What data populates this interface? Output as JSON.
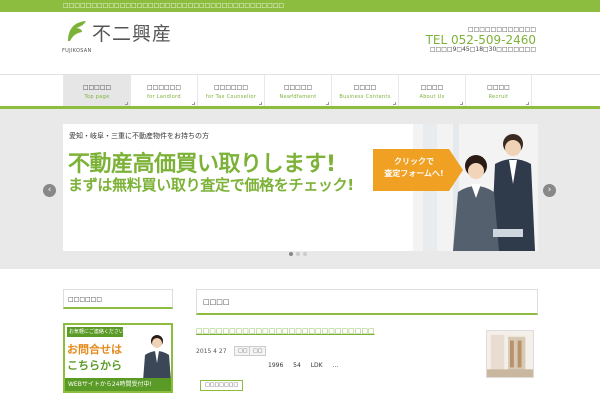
{
  "topbar": {
    "text": "□□□□□□□□□□□□□□□□□□□□□□□□□□□□□□□□□□□□□□□"
  },
  "header": {
    "logo_sub": "FUJIKOSAN",
    "logo_text": "不二興産",
    "company_name": "□□□□□□□□□□□□",
    "tel": "TEL 052-509-2460",
    "hours": "□□□□9□45□18□30□□□□□□□"
  },
  "nav": {
    "items": [
      {
        "jp": "□□□□□",
        "en": "Top page"
      },
      {
        "jp": "□□□□□□",
        "en": "for Landlord"
      },
      {
        "jp": "□□□□□□",
        "en": "for Tax Counsellor"
      },
      {
        "jp": "□□□□□",
        "en": "Newfdfament"
      },
      {
        "jp": "□□□□",
        "en": "Business Contents"
      },
      {
        "jp": "□□□□",
        "en": "About Us"
      },
      {
        "jp": "□□□□",
        "en": "Recruit"
      }
    ]
  },
  "slider": {
    "sub": "愛知・岐阜・三重に不動産物件をお持ちの方",
    "headline": "不動産高価買い取りします!",
    "subheadline": "まずは無料買い取り査定で価格をチェック!",
    "cta": "クリックで\n査定フォームへ!",
    "prev": "‹",
    "next": "›"
  },
  "sidebar": {
    "title": "□□□□□□",
    "banner": {
      "line1": "お気軽にご連絡ください!",
      "line2": "お問合せは",
      "line3": "こちらから",
      "line4": "WEBサイトから24時間受付中!"
    }
  },
  "main": {
    "title": "□□□□",
    "post": {
      "link": "□□□□□□□□□□□□□□□□□□□□□□□□□□□",
      "date": "2015 4 27",
      "tags": [
        "□□",
        "□□"
      ],
      "excerpt": "1996 54 LDK …",
      "more": "□□□□□□□"
    }
  },
  "colors": {
    "accent": "#8cbd3f",
    "accent_text": "#7db238",
    "cta": "#f0a022"
  }
}
